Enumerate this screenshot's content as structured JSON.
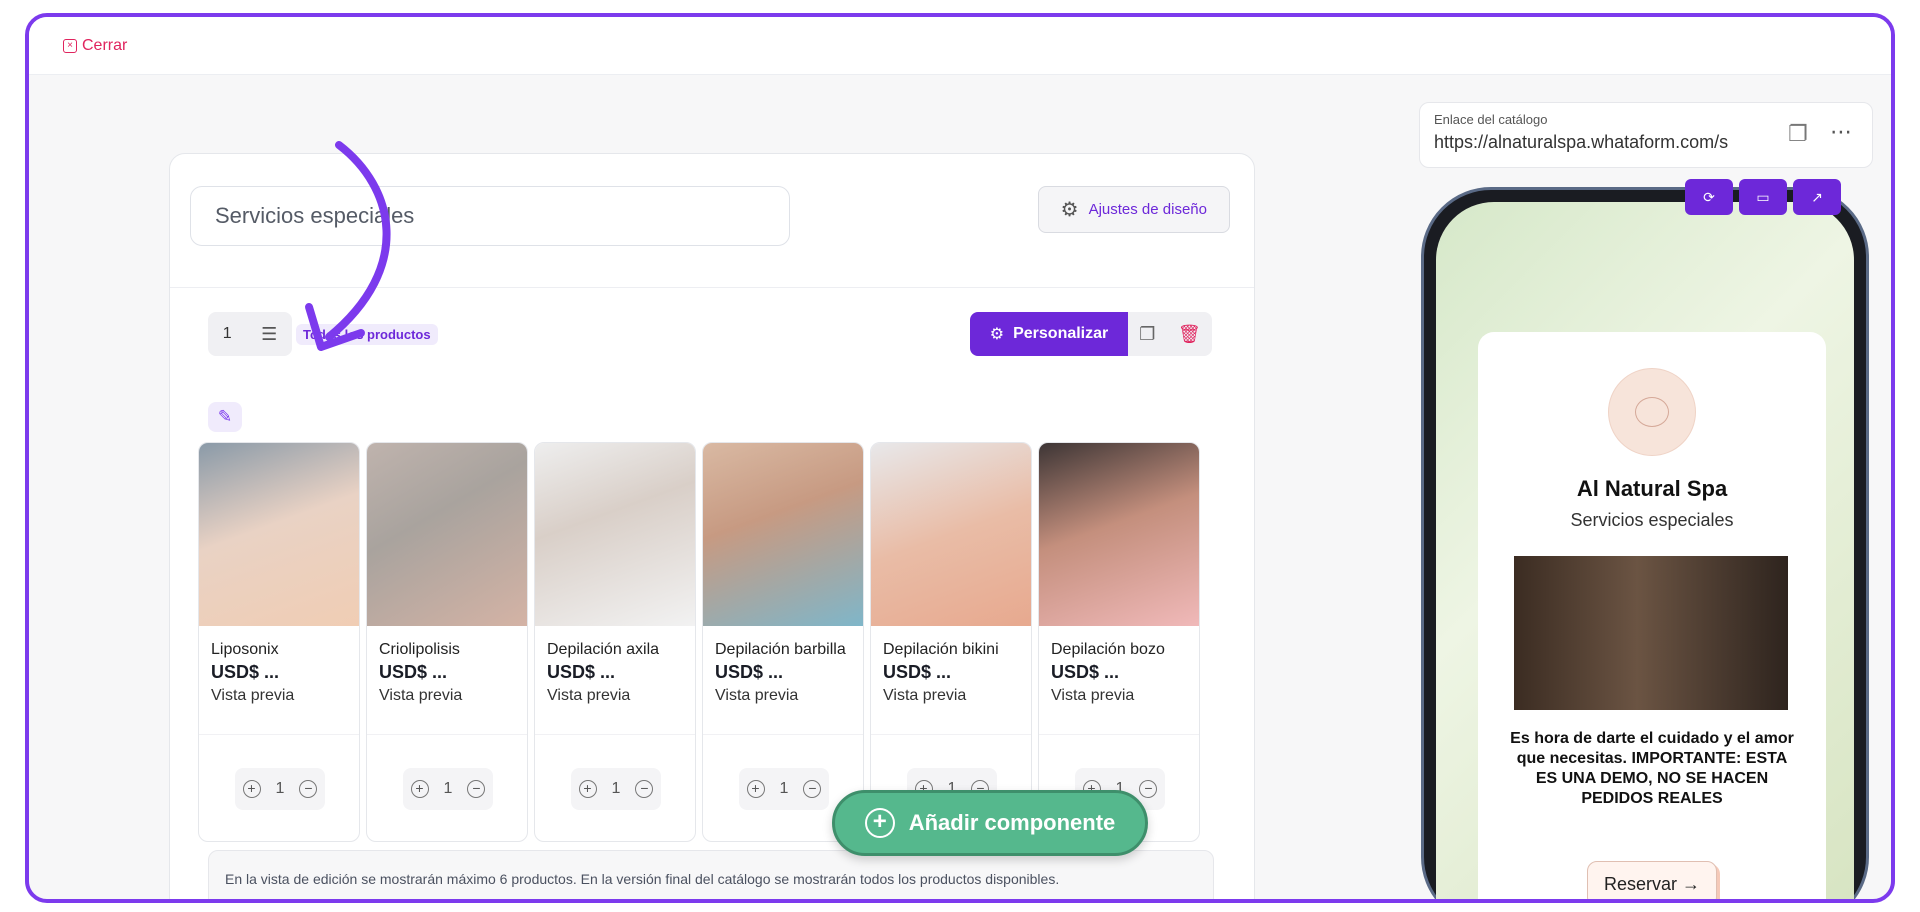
{
  "topbar": {
    "close_label": "Cerrar"
  },
  "editor": {
    "title_value": "Servicios especiales",
    "design_button": "Ajustes de diseño",
    "rows_count": "1",
    "filter_tag": "Todos los productos",
    "personalize_button": "Personalizar",
    "note": "En la vista de edición se mostrarán máximo 6 productos. En la versión final del catálogo se mostrarán todos los productos disponibles."
  },
  "products": [
    {
      "name": "Liposonix",
      "price": "USD$ ...",
      "preview": "Vista previa",
      "qty": "1"
    },
    {
      "name": "Criolipolisis",
      "price": "USD$ ...",
      "preview": "Vista previa",
      "qty": "1"
    },
    {
      "name": "Depilación axila",
      "price": "USD$ ...",
      "preview": "Vista previa",
      "qty": "1"
    },
    {
      "name": "Depilación barbilla",
      "price": "USD$ ...",
      "preview": "Vista previa",
      "qty": "1"
    },
    {
      "name": "Depilación bikini",
      "price": "USD$ ...",
      "preview": "Vista previa",
      "qty": "1"
    },
    {
      "name": "Depilación bozo",
      "price": "USD$ ...",
      "preview": "Vista previa",
      "qty": "1"
    }
  ],
  "add_component_button": "Añadir componente",
  "catalog_link": {
    "label": "Enlace del catálogo",
    "url": "https://alnaturalspa.whataform.com/s"
  },
  "preview": {
    "business_name": "Al Natural Spa",
    "subtitle": "Servicios especiales",
    "message": "Es hora de darte el cuidado y el amor que necesitas. IMPORTANTE: ESTA ES UNA DEMO, NO SE HACEN PEDIDOS REALES",
    "reserve_button": "Reservar →"
  },
  "colors": {
    "accent": "#6d28d9",
    "danger": "#e0245e",
    "add_button": "#55b88d"
  },
  "icons": [
    "close-icon",
    "gear-icon",
    "rows-icon",
    "copy-icon",
    "trash-icon",
    "pencil-icon",
    "plus-icon",
    "minus-icon",
    "refresh-icon",
    "monitor-icon",
    "external-link-icon",
    "more-icon"
  ]
}
